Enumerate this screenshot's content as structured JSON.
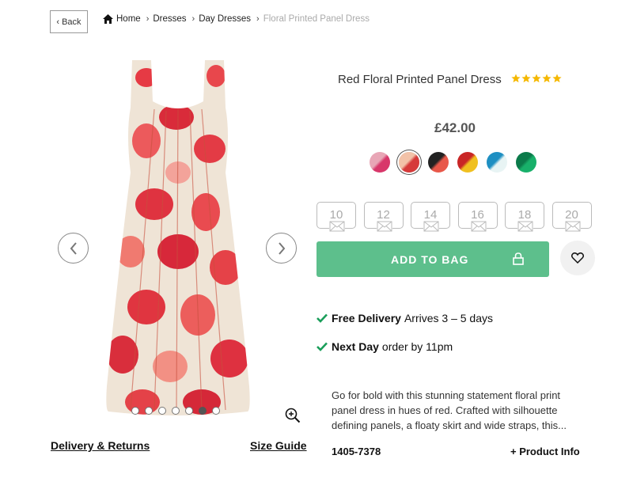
{
  "nav": {
    "back_label": "Back",
    "breadcrumb": [
      "Home",
      "Dresses",
      "Day Dresses",
      "Floral Printed Panel Dress"
    ]
  },
  "gallery": {
    "image_count": 7,
    "active_index": 5,
    "delivery_returns_label": "Delivery & Returns",
    "size_guide_label": "Size Guide"
  },
  "product": {
    "title": "Red Floral Printed Panel Dress",
    "rating": 5,
    "rating_max": 5,
    "price": "£42.00",
    "swatches": [
      {
        "colors": [
          "#e8a6b6",
          "#d8376a"
        ]
      },
      {
        "colors": [
          "#f2c2a8",
          "#d63a3a"
        ],
        "selected": true
      },
      {
        "colors": [
          "#222222",
          "#e8584a"
        ]
      },
      {
        "colors": [
          "#c92626",
          "#f0c020"
        ]
      },
      {
        "colors": [
          "#1e8fc2",
          "#e8f4f4"
        ]
      },
      {
        "colors": [
          "#0b7a4a",
          "#18b06a"
        ]
      }
    ],
    "sizes": [
      "10",
      "12",
      "14",
      "16",
      "18",
      "20"
    ],
    "add_to_bag_label": "ADD TO BAG",
    "benefits": [
      {
        "bold": "Free Delivery",
        "text": "Arrives 3 – 5 days"
      },
      {
        "bold": "Next Day",
        "text": "order by 11pm"
      }
    ],
    "description": "Go for bold with this stunning statement floral print panel dress in hues of red. Crafted with silhouette defining panels, a floaty skirt and wide straps, this...",
    "sku": "1405-7378",
    "product_info_label": "+ Product Info"
  },
  "colors": {
    "accent_green": "#5dbf8c",
    "check_green": "#1a9e5a",
    "star_gold": "#f5b800"
  },
  "icons": [
    "home-icon",
    "chevron-left-icon",
    "chevron-right-icon",
    "zoom-in-icon",
    "star-icon",
    "envelope-icon",
    "lock-icon",
    "heart-icon",
    "check-icon"
  ]
}
